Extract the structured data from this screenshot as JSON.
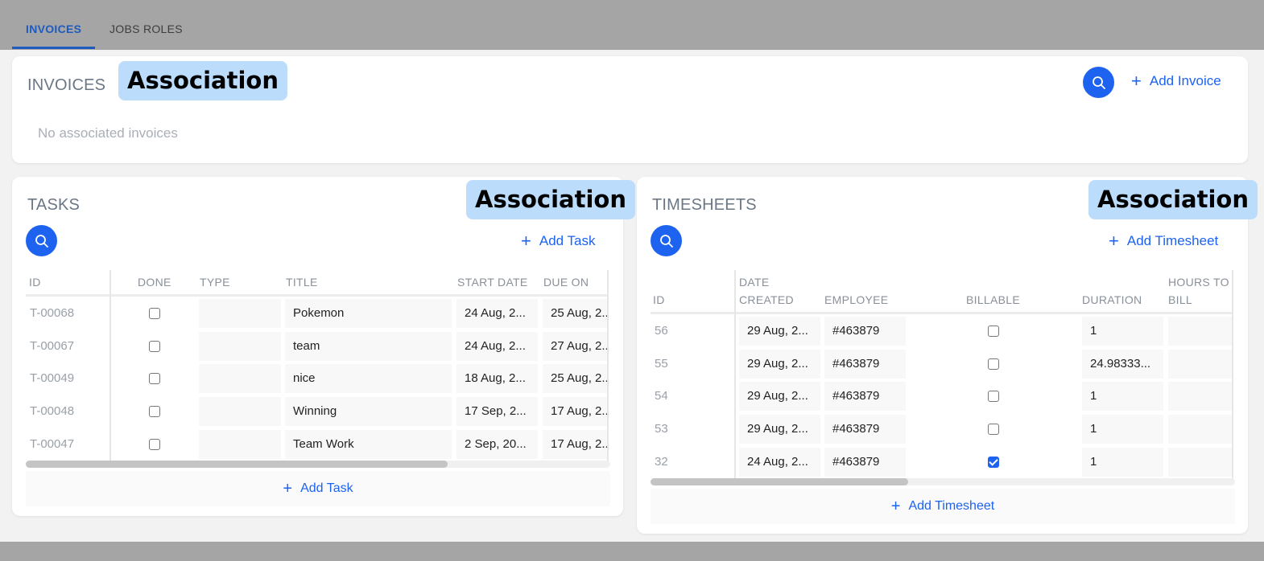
{
  "tabs": [
    {
      "label": "INVOICES",
      "active": true
    },
    {
      "label": "JOBS ROLES",
      "active": false
    }
  ],
  "association_label": "Association",
  "invoices": {
    "title": "INVOICES",
    "add_label": "Add Invoice",
    "empty_text": "No associated invoices"
  },
  "tasks": {
    "title": "TASKS",
    "add_label": "Add Task",
    "footer_add_label": "Add Task",
    "columns": [
      "ID",
      "DONE",
      "TYPE",
      "TITLE",
      "START DATE",
      "DUE ON"
    ],
    "rows": [
      {
        "id": "T-00068",
        "done": false,
        "type": "",
        "title": "Pokemon",
        "start": "24 Aug, 2...",
        "due": "25 Aug, 2..."
      },
      {
        "id": "T-00067",
        "done": false,
        "type": "",
        "title": "team",
        "start": "24 Aug, 2...",
        "due": "27 Aug, 2..."
      },
      {
        "id": "T-00049",
        "done": false,
        "type": "",
        "title": "nice",
        "start": "18 Aug, 2...",
        "due": "25 Aug, 2..."
      },
      {
        "id": "T-00048",
        "done": false,
        "type": "",
        "title": "Winning",
        "start": "17 Sep, 2...",
        "due": "17 Aug, 2..."
      },
      {
        "id": "T-00047",
        "done": false,
        "type": "",
        "title": "Team Work",
        "start": "2 Sep, 20...",
        "due": "17 Aug, 2..."
      }
    ]
  },
  "timesheets": {
    "title": "TIMESHEETS",
    "add_label": "Add Timesheet",
    "footer_add_label": "Add Timesheet",
    "columns": {
      "id": "ID",
      "date_created_line1": "DATE",
      "date_created_line2": "CREATED",
      "employee": "EMPLOYEE",
      "billable": "BILLABLE",
      "duration": "DURATION",
      "hours_line1": "HOURS TO",
      "hours_line2": "BILL"
    },
    "rows": [
      {
        "id": "56",
        "date": "29 Aug, 2...",
        "employee": "#463879",
        "billable": false,
        "duration": "1",
        "hours": ""
      },
      {
        "id": "55",
        "date": "29 Aug, 2...",
        "employee": "#463879",
        "billable": false,
        "duration": "24.98333...",
        "hours": ""
      },
      {
        "id": "54",
        "date": "29 Aug, 2...",
        "employee": "#463879",
        "billable": false,
        "duration": "1",
        "hours": ""
      },
      {
        "id": "53",
        "date": "29 Aug, 2...",
        "employee": "#463879",
        "billable": false,
        "duration": "1",
        "hours": ""
      },
      {
        "id": "32",
        "date": "24 Aug, 2...",
        "employee": "#463879",
        "billable": true,
        "duration": "1",
        "hours": ""
      }
    ]
  },
  "colors": {
    "accent": "#1d63f0",
    "tab_active": "#1f5bbf",
    "association_bg": "#bcdcfb"
  },
  "icons": {
    "search": "search-icon",
    "plus": "plus-icon",
    "checkbox": "checkbox-icon"
  }
}
